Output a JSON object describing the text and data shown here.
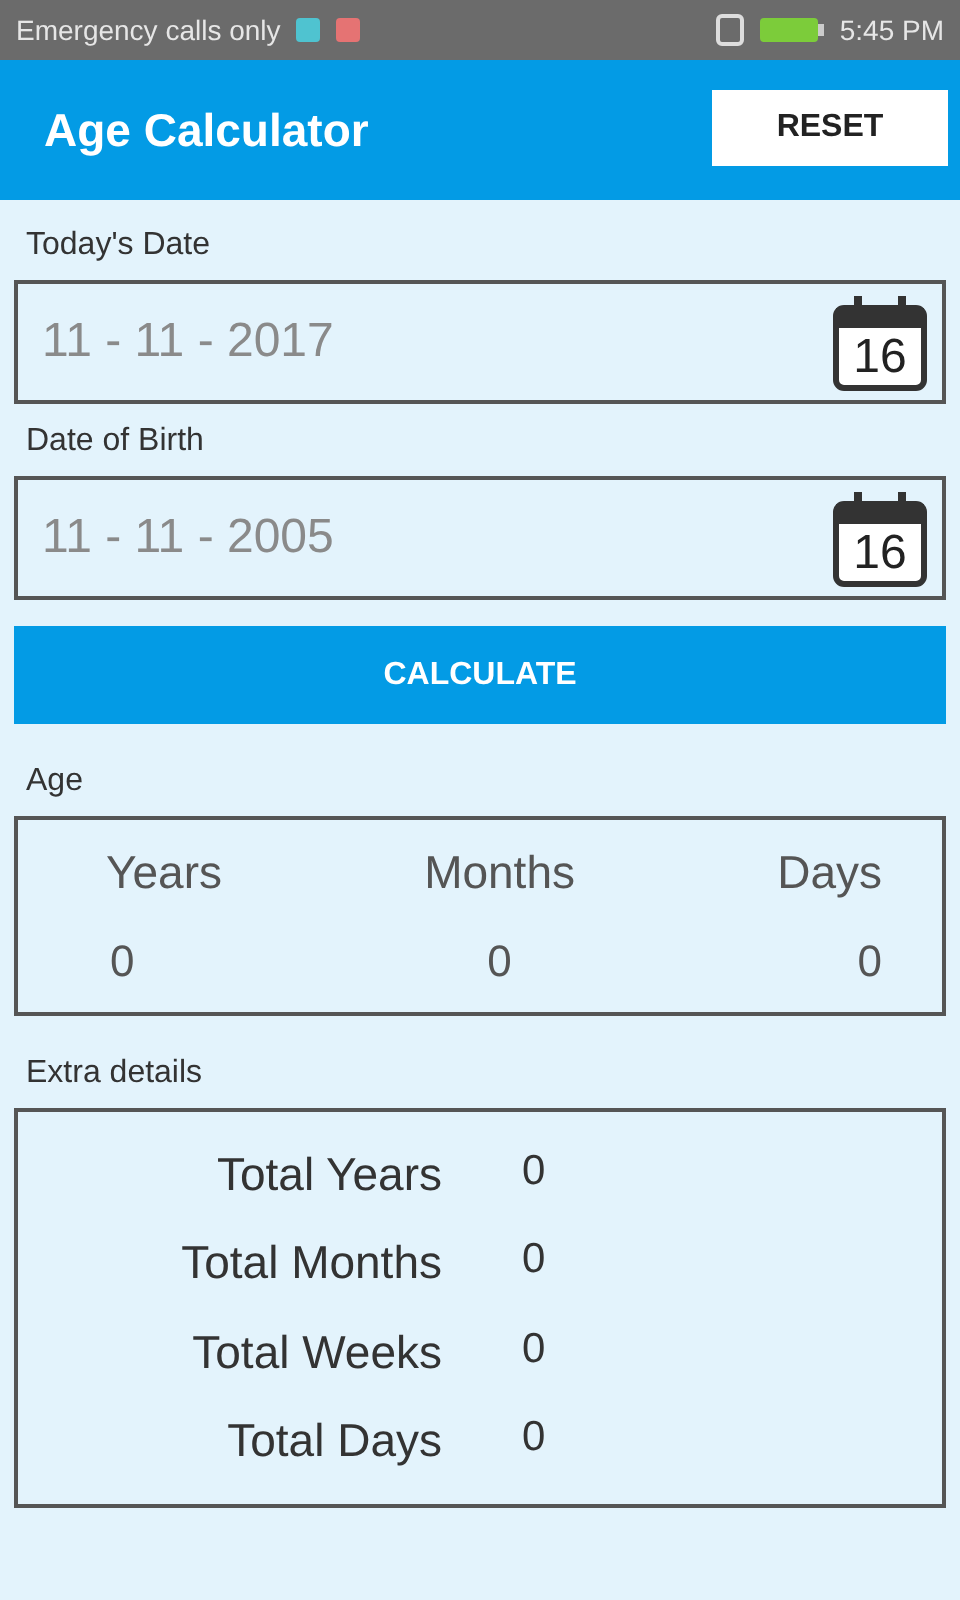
{
  "status_bar": {
    "carrier": "Emergency calls only",
    "time": "5:45 PM"
  },
  "app_bar": {
    "title": "Age Calculator",
    "reset_button": "RESET"
  },
  "fields": [
    {
      "label": "Today's Date",
      "value": "11 - 11 - 2017",
      "calendar_day": "16"
    },
    {
      "label": "Date of Birth",
      "value": "11 - 11 - 2005",
      "calendar_day": "16"
    }
  ],
  "calculate_button": "CALCULATE",
  "age": {
    "label": "Age",
    "columns": [
      {
        "heading": "Years",
        "value": "0"
      },
      {
        "heading": "Months",
        "value": "0"
      },
      {
        "heading": "Days",
        "value": "0"
      }
    ]
  },
  "extra": {
    "label": "Extra details",
    "rows": [
      {
        "name": "Total Years",
        "value": "0"
      },
      {
        "name": "Total Months",
        "value": "0"
      },
      {
        "name": "Total Weeks",
        "value": "0"
      },
      {
        "name": "Total Days",
        "value": "0"
      }
    ]
  }
}
